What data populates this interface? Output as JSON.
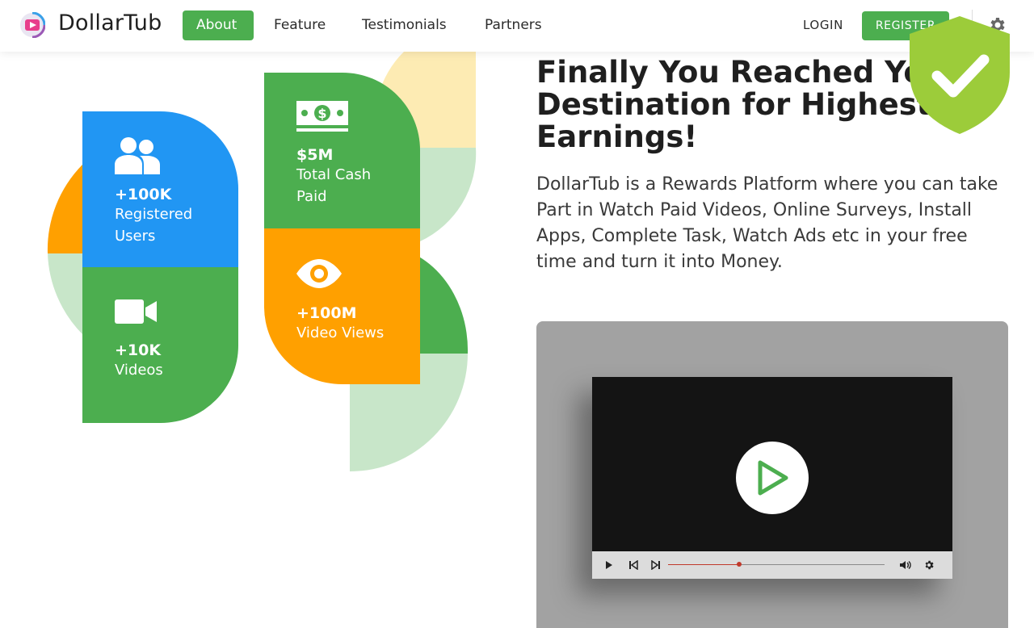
{
  "brand": {
    "name": "DollarTub"
  },
  "nav": {
    "links": [
      {
        "label": "About",
        "active": true
      },
      {
        "label": "Feature",
        "active": false
      },
      {
        "label": "Testimonials",
        "active": false
      },
      {
        "label": "Partners",
        "active": false
      }
    ],
    "login_label": "LOGIN",
    "register_label": "REGISTER"
  },
  "stats": [
    {
      "value": "+100K",
      "label": "Registered Users",
      "icon": "users-icon"
    },
    {
      "value": "+10K",
      "label": "Videos",
      "icon": "video-camera-icon"
    },
    {
      "value": "$5M",
      "label": "Total Cash Paid",
      "icon": "cash-icon"
    },
    {
      "value": "+100M",
      "label": "Video Views",
      "icon": "eye-icon"
    }
  ],
  "hero": {
    "headline": "Finally You Reached Your Destination for Highest Earnings!",
    "description": "DollarTub is a Rewards Platform where you can take Part in Watch Paid Videos, Online Surveys, Install Apps, Complete Task, Watch Ads etc in your free time and turn it into Money."
  },
  "video": {
    "progress_fraction": 0.33
  },
  "colors": {
    "green": "#4cae4f",
    "blue": "#2196f3",
    "orange": "#ffa000",
    "light_green": "#c8e6c9",
    "light_yellow": "#fdebb3",
    "shield_green": "#9ccc3a"
  }
}
